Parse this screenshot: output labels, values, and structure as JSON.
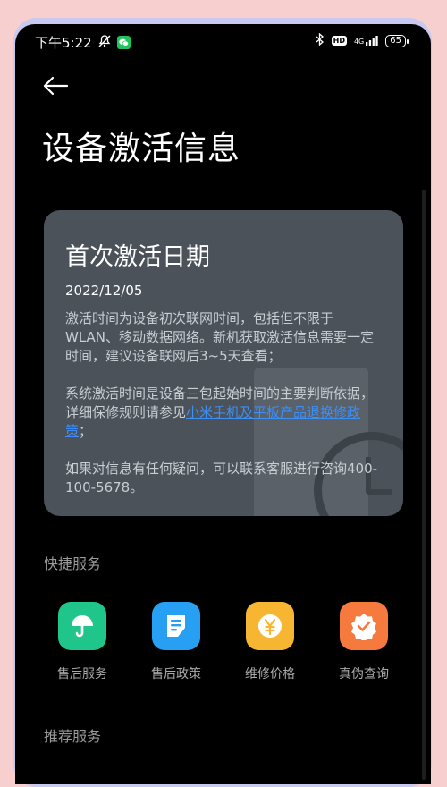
{
  "status_bar": {
    "time": "下午5:22",
    "network": "4G",
    "battery": "65"
  },
  "page": {
    "title": "设备激活信息"
  },
  "activation_card": {
    "title": "首次激活日期",
    "date": "2022/12/05",
    "para1": "激活时间为设备初次联网时间，包括但不限于WLAN、移动数据网络。新机获取激活信息需要一定时间，建议设备联网后3~5天查看；",
    "para2_before": "系统激活时间是设备三包起始时间的主要判断依据，详细保修规则请参见",
    "para2_link": "小米手机及平板产品退换修政策",
    "para2_after": "；",
    "para3": "如果对信息有任何疑问，可以联系客服进行咨询400-100-5678。"
  },
  "quick_services": {
    "label": "快捷服务",
    "items": [
      {
        "label": "售后服务",
        "color": "#1fc58a",
        "icon": "umbrella-icon"
      },
      {
        "label": "售后政策",
        "color": "#27a0f4",
        "icon": "document-icon"
      },
      {
        "label": "维修价格",
        "color": "#f7b631",
        "icon": "yen-coin-icon"
      },
      {
        "label": "真伪查询",
        "color": "#f67a3e",
        "icon": "verified-badge-icon"
      }
    ]
  },
  "recommended": {
    "label": "推荐服务"
  }
}
